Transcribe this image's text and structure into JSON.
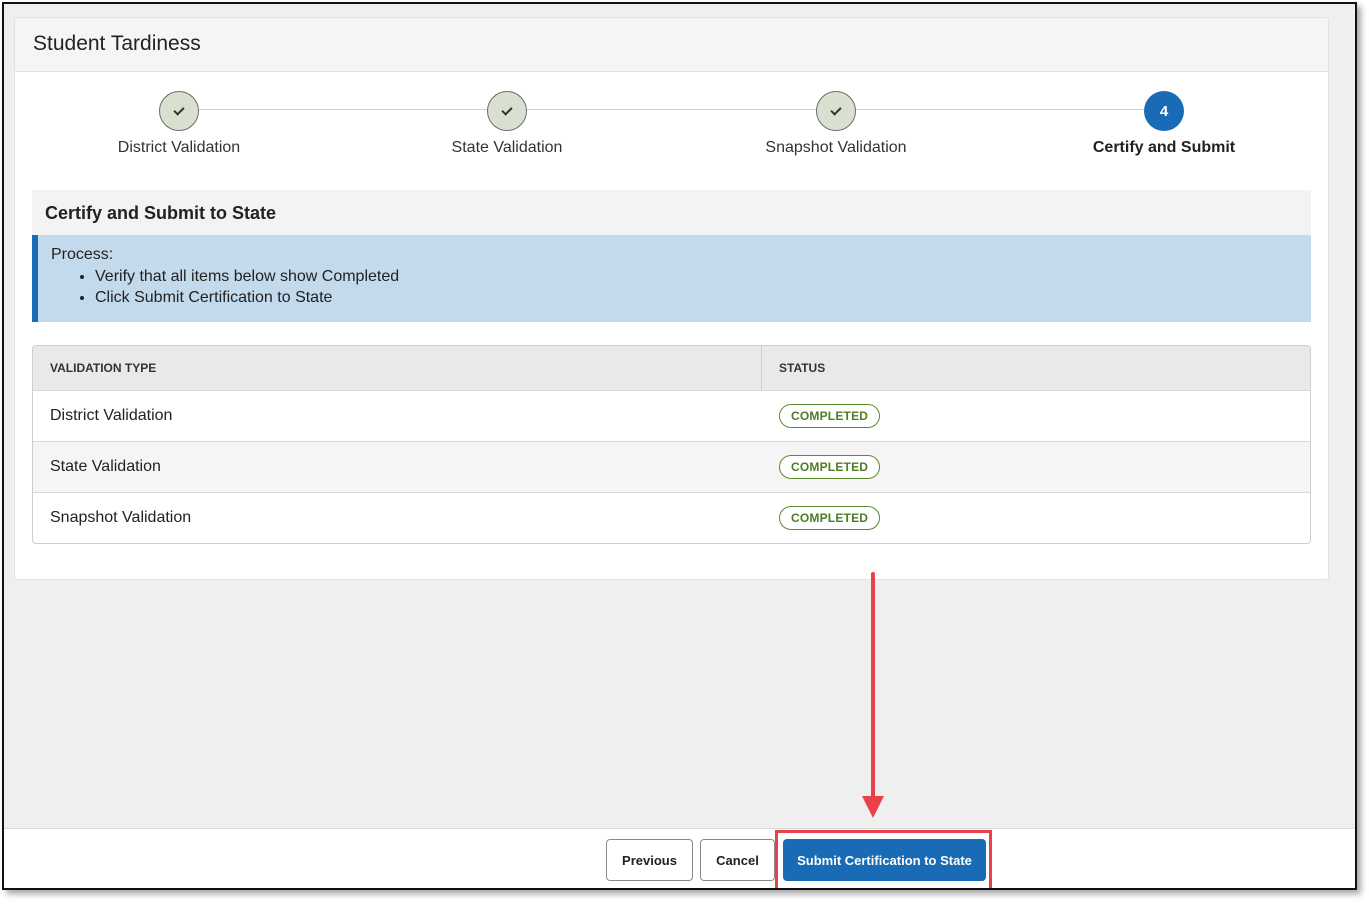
{
  "page": {
    "title": "Student Tardiness"
  },
  "steps": [
    {
      "label": "District Validation",
      "state": "complete"
    },
    {
      "label": "State Validation",
      "state": "complete"
    },
    {
      "label": "Snapshot Validation",
      "state": "complete"
    },
    {
      "label": "Certify and Submit",
      "state": "active",
      "number": "4"
    }
  ],
  "section": {
    "title": "Certify and Submit to State",
    "process_heading": "Process:",
    "process_items": [
      "Verify that all items below show Completed",
      "Click Submit Certification to State"
    ]
  },
  "table": {
    "headers": {
      "type": "VALIDATION TYPE",
      "status": "STATUS"
    },
    "rows": [
      {
        "type": "District Validation",
        "status": "COMPLETED"
      },
      {
        "type": "State Validation",
        "status": "COMPLETED"
      },
      {
        "type": "Snapshot Validation",
        "status": "COMPLETED"
      }
    ]
  },
  "footer": {
    "previous_label": "Previous",
    "cancel_label": "Cancel",
    "submit_label": "Submit Certification to State"
  },
  "colors": {
    "primary": "#1a6bb5",
    "completed_badge": "#4e7d22",
    "annotation": "#e8414a",
    "process_bg": "#c3d9ec"
  }
}
